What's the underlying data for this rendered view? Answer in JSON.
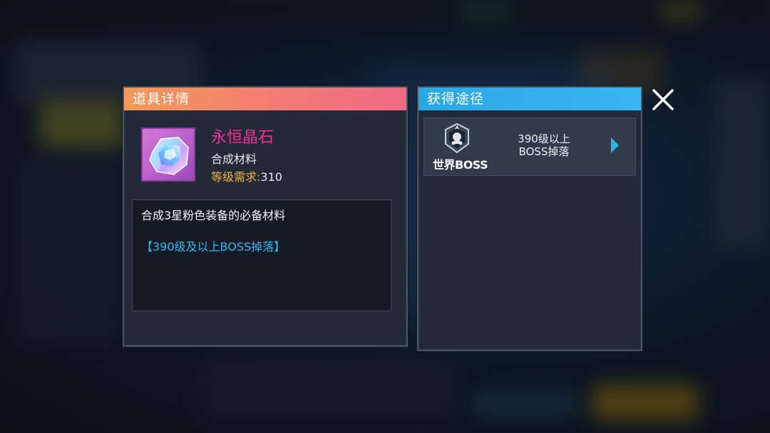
{
  "item_panel": {
    "header": "道具详情",
    "item": {
      "name": "永恒晶石",
      "type": "合成材料",
      "level_label": "等级需求",
      "level_value": "310",
      "icon": "crystal-gem-icon",
      "name_color": "#ee2f98"
    },
    "description": "合成3星粉色装备的必备材料",
    "source_note": "【390级及以上BOSS掉落】"
  },
  "acquire_panel": {
    "header": "获得途径",
    "routes": [
      {
        "label": "世界BOSS",
        "icon": "world-boss-icon",
        "desc_line1": "390级以上",
        "desc_line2": "BOSS掉落"
      }
    ]
  },
  "colors": {
    "left_header_gradient": [
      "#f29a58",
      "#f06a86"
    ],
    "right_header": "#2aa8e6",
    "level_label": "#f0b23c",
    "source_text": "#2fb7f0"
  },
  "close_icon": "close-icon"
}
